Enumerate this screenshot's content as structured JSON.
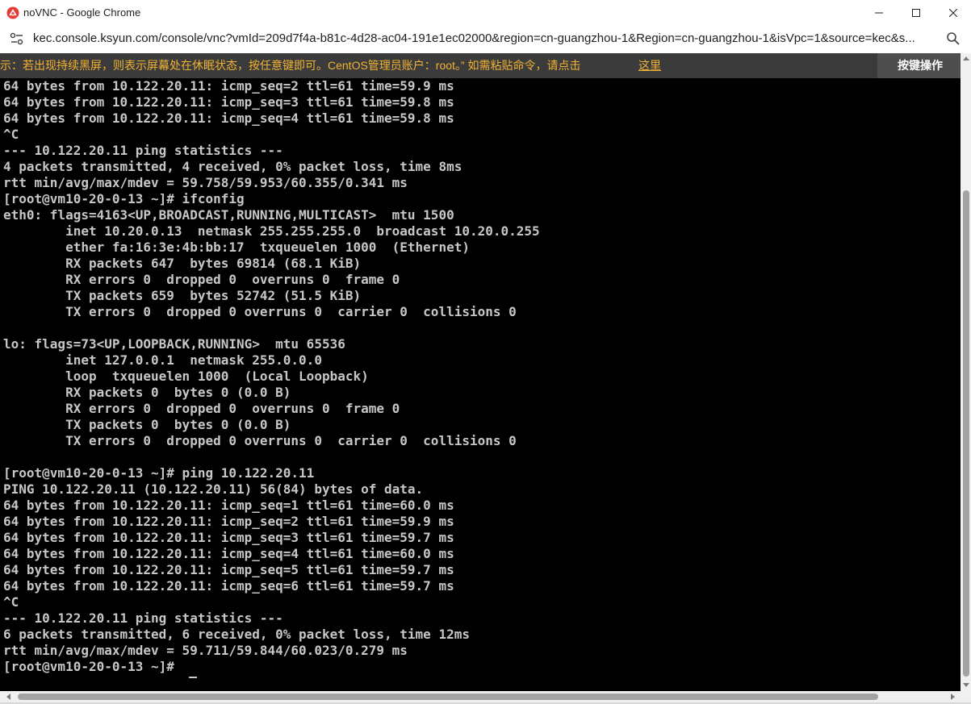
{
  "window": {
    "title": "noVNC - Google Chrome",
    "app_icon": "novnc-logo-icon",
    "accent_color": "#e53935"
  },
  "browser": {
    "url": "kec.console.ksyun.com/console/vnc?vmId=209d7f4a-b81c-4d28-ac04-191e1ec02000&region=cn-guangzhou-1&Region=cn-guangzhou-1&isVpc=1&source=kec&s..."
  },
  "notice": {
    "text": "示：若出现持续黑屏，则表示屏幕处在休眠状态，按任意键即可。CentOS管理员账户：root。”  如需粘贴命令，请点击",
    "link": "这里",
    "color": "#f2b233"
  },
  "toolbar": {
    "keys_button": "按键操作"
  },
  "terminal": {
    "lines": [
      "64 bytes from 10.122.20.11: icmp_seq=2 ttl=61 time=59.9 ms",
      "64 bytes from 10.122.20.11: icmp_seq=3 ttl=61 time=59.8 ms",
      "64 bytes from 10.122.20.11: icmp_seq=4 ttl=61 time=59.8 ms",
      "^C",
      "--- 10.122.20.11 ping statistics ---",
      "4 packets transmitted, 4 received, 0% packet loss, time 8ms",
      "rtt min/avg/max/mdev = 59.758/59.953/60.355/0.341 ms",
      "[root@vm10-20-0-13 ~]# ifconfig",
      "eth0: flags=4163<UP,BROADCAST,RUNNING,MULTICAST>  mtu 1500",
      "        inet 10.20.0.13  netmask 255.255.255.0  broadcast 10.20.0.255",
      "        ether fa:16:3e:4b:bb:17  txqueuelen 1000  (Ethernet)",
      "        RX packets 647  bytes 69814 (68.1 KiB)",
      "        RX errors 0  dropped 0  overruns 0  frame 0",
      "        TX packets 659  bytes 52742 (51.5 KiB)",
      "        TX errors 0  dropped 0 overruns 0  carrier 0  collisions 0",
      "",
      "lo: flags=73<UP,LOOPBACK,RUNNING>  mtu 65536",
      "        inet 127.0.0.1  netmask 255.0.0.0",
      "        loop  txqueuelen 1000  (Local Loopback)",
      "        RX packets 0  bytes 0 (0.0 B)",
      "        RX errors 0  dropped 0  overruns 0  frame 0",
      "        TX packets 0  bytes 0 (0.0 B)",
      "        TX errors 0  dropped 0 overruns 0  carrier 0  collisions 0",
      "",
      "[root@vm10-20-0-13 ~]# ping 10.122.20.11",
      "PING 10.122.20.11 (10.122.20.11) 56(84) bytes of data.",
      "64 bytes from 10.122.20.11: icmp_seq=1 ttl=61 time=60.0 ms",
      "64 bytes from 10.122.20.11: icmp_seq=2 ttl=61 time=59.9 ms",
      "64 bytes from 10.122.20.11: icmp_seq=3 ttl=61 time=59.7 ms",
      "64 bytes from 10.122.20.11: icmp_seq=4 ttl=61 time=60.0 ms",
      "64 bytes from 10.122.20.11: icmp_seq=5 ttl=61 time=59.7 ms",
      "64 bytes from 10.122.20.11: icmp_seq=6 ttl=61 time=59.7 ms",
      "^C",
      "--- 10.122.20.11 ping statistics ---",
      "6 packets transmitted, 6 received, 0% packet loss, time 12ms",
      "rtt min/avg/max/mdev = 59.711/59.844/60.023/0.279 ms",
      "[root@vm10-20-0-13 ~]# "
    ]
  }
}
